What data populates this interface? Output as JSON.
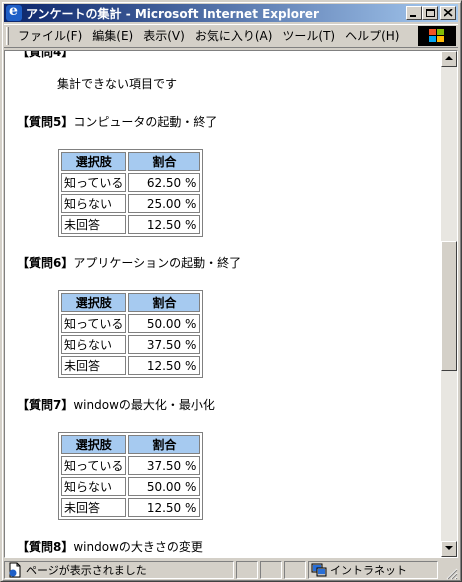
{
  "window": {
    "title": "アンケートの集計 - Microsoft Internet Explorer",
    "icon": "ie-icon"
  },
  "menu": {
    "items": [
      {
        "label": "ファイル(F)"
      },
      {
        "label": "編集(E)"
      },
      {
        "label": "表示(V)"
      },
      {
        "label": "お気に入り(A)"
      },
      {
        "label": "ツール(T)"
      },
      {
        "label": "ヘルプ(H)"
      }
    ]
  },
  "page": {
    "top_note": "集計できない項目です",
    "table_headers": {
      "choice": "選択肢",
      "ratio": "割合"
    },
    "questions": [
      {
        "prefix": "【質問5】",
        "title": "コンピュータの起動・終了",
        "rows": [
          {
            "choice": "知っている",
            "ratio": "62.50 %"
          },
          {
            "choice": "知らない",
            "ratio": "25.00 %"
          },
          {
            "choice": "未回答",
            "ratio": "12.50 %"
          }
        ]
      },
      {
        "prefix": "【質問6】",
        "title": "アプリケーションの起動・終了",
        "rows": [
          {
            "choice": "知っている",
            "ratio": "50.00 %"
          },
          {
            "choice": "知らない",
            "ratio": "37.50 %"
          },
          {
            "choice": "未回答",
            "ratio": "12.50 %"
          }
        ]
      },
      {
        "prefix": "【質問7】",
        "title": "windowの最大化・最小化",
        "rows": [
          {
            "choice": "知っている",
            "ratio": "37.50 %"
          },
          {
            "choice": "知らない",
            "ratio": "50.00 %"
          },
          {
            "choice": "未回答",
            "ratio": "12.50 %"
          }
        ]
      },
      {
        "prefix": "【質問8】",
        "title": "windowの大きさの変更"
      }
    ]
  },
  "status": {
    "text": "ページが表示されました",
    "zone": "イントラネット"
  },
  "colors": {
    "title_gradient_start": "#0a246a",
    "title_gradient_end": "#a6caf0",
    "table_header_bg": "#a6caf0",
    "chrome": "#d4d0c8"
  }
}
